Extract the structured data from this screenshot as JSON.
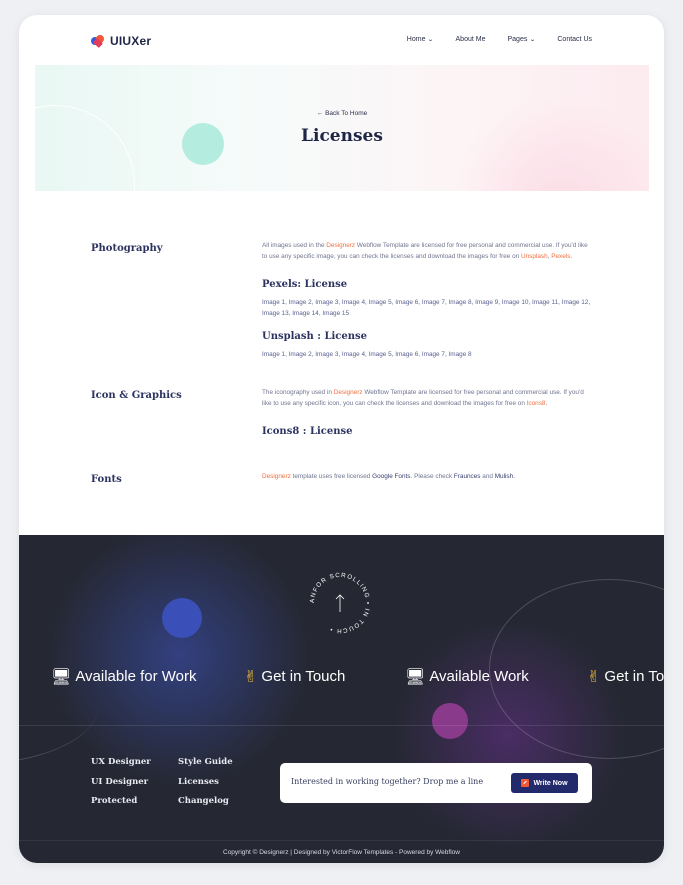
{
  "header": {
    "logo_text": "UIUXer",
    "nav": [
      {
        "label": "Home",
        "has_dropdown": true
      },
      {
        "label": "About Me",
        "has_dropdown": false
      },
      {
        "label": "Pages",
        "has_dropdown": true
      },
      {
        "label": "Contact Us",
        "has_dropdown": false
      }
    ]
  },
  "hero": {
    "back_label": "Back To Home",
    "title": "Licenses"
  },
  "sections": {
    "photography": {
      "title": "Photography",
      "intro_1": "All images used in the ",
      "brand": "Designerz",
      "intro_2": " Webflow Template are licensed for free personal and commercial use. If you'd like to use any specific image, you can check the licenses and download the images for free on ",
      "link_unsplash": "Unsplash",
      "sep": ", ",
      "link_pexels": "Pexels",
      "end": ".",
      "pexels_heading": "Pexels: License",
      "pexels_images": "Image 1, Image 2, Image 3, Image 4, Image 5, Image 6, Image 7, Image 8, Image 9, Image 10, Image 11, Image 12, Image 13, Image 14, Image 15",
      "unsplash_heading": "Unsplash : License",
      "unsplash_images": "Image 1, Image 2, Image 3, Image 4, Image 5, Image 6, Image 7, Image 8"
    },
    "icons": {
      "title": "Icon & Graphics",
      "intro_1": "The iconography used in ",
      "brand": "Designerz",
      "intro_2": " Webflow Template are licensed for free personal and commercial use. If you'd like to use any specific icon, you can check the licenses and download the images for free on ",
      "link_icons8": "Icons8",
      "end": ".",
      "icons8_heading": "Icons8 : License"
    },
    "fonts": {
      "title": "Fonts",
      "brand": "Designerz",
      "text_1": " template uses free licensed ",
      "google_fonts": "Google Fonts",
      "text_2": ". Please check ",
      "font_fraunces": "Fraunces",
      "text_3": " and ",
      "font_mulish": "Mulish",
      "end": "."
    }
  },
  "footer": {
    "scroll_badge_text": "ANFOR SCROLLING • IN TOUCH • ",
    "marquee": [
      {
        "emoji": "🖥",
        "label": "Available for Work"
      },
      {
        "emoji": "✌",
        "label": "Get in Touch"
      },
      {
        "emoji": "🖥",
        "label": "Available Work"
      },
      {
        "emoji": "✌",
        "label": "Get in To"
      }
    ],
    "links_col1": [
      "UX Designer",
      "UI Designer",
      "Protected"
    ],
    "links_col2": [
      "Style Guide",
      "Licenses",
      "Changelog"
    ],
    "cta_text": "Interested in working together? Drop me a line",
    "cta_button": "Write Now",
    "copyright": "Copyright © Designerz | Designed by VictorFlow Templates - Powered by Webflow"
  },
  "colors": {
    "accent_orange": "#f0703e",
    "navy": "#1e2546",
    "footer_bg": "#252833",
    "button_bg": "#232a6b"
  }
}
